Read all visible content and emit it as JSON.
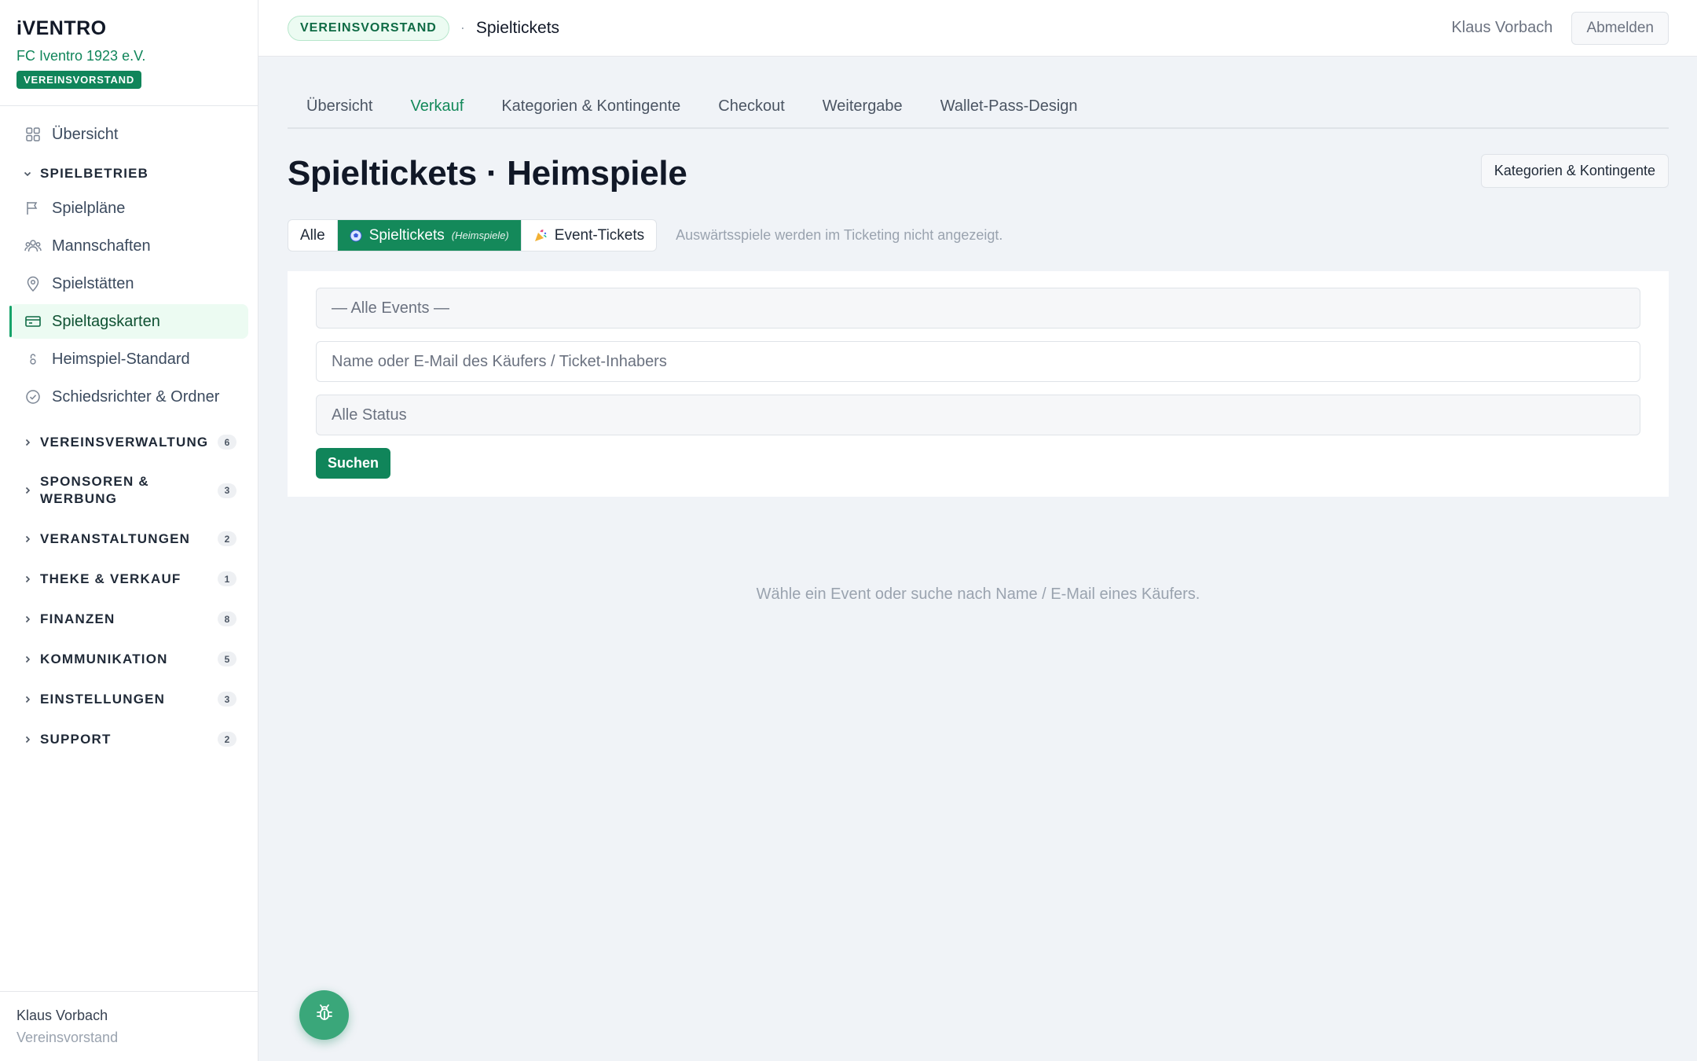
{
  "brand": {
    "logo": "iVENTRO",
    "club": "FC Iventro 1923 e.V.",
    "role_badge": "VEREINSVORSTAND"
  },
  "sidebar": {
    "top_item": {
      "label": "Übersicht",
      "icon": "grid-icon"
    },
    "open_group": {
      "label": "SPIELBETRIEB",
      "items": [
        {
          "label": "Spielpläne",
          "icon": "flag-icon"
        },
        {
          "label": "Mannschaften",
          "icon": "users-icon"
        },
        {
          "label": "Spielstätten",
          "icon": "map-pin-icon"
        },
        {
          "label": "Spieltagskarten",
          "icon": "ticket-icon",
          "active": true
        },
        {
          "label": "Heimspiel-Standard",
          "icon": "lock-icon"
        },
        {
          "label": "Schiedsrichter & Ordner",
          "icon": "check-circle-icon"
        }
      ]
    },
    "groups": [
      {
        "label": "VEREINSVERWALTUNG",
        "count": "6"
      },
      {
        "label": "SPONSOREN & WERBUNG",
        "count": "3"
      },
      {
        "label": "VERANSTALTUNGEN",
        "count": "2"
      },
      {
        "label": "THEKE & VERKAUF",
        "count": "1"
      },
      {
        "label": "FINANZEN",
        "count": "8"
      },
      {
        "label": "KOMMUNIKATION",
        "count": "5"
      },
      {
        "label": "EINSTELLUNGEN",
        "count": "3"
      },
      {
        "label": "SUPPORT",
        "count": "2"
      }
    ],
    "user": {
      "name": "Klaus Vorbach",
      "role": "Vereinsvorstand"
    }
  },
  "topbar": {
    "breadcrumb_badge": "VEREINSVORSTAND",
    "breadcrumb_sep": "·",
    "breadcrumb_title": "Spieltickets",
    "user": "Klaus Vorbach",
    "logout": "Abmelden"
  },
  "tabs": [
    {
      "label": "Übersicht",
      "active": false
    },
    {
      "label": "Verkauf",
      "active": true
    },
    {
      "label": "Kategorien & Kontingente",
      "active": false
    },
    {
      "label": "Checkout",
      "active": false
    },
    {
      "label": "Weitergabe",
      "active": false
    },
    {
      "label": "Wallet-Pass-Design",
      "active": false
    }
  ],
  "page": {
    "title": "Spieltickets · Heimspiele",
    "header_button": "Kategorien & Kontingente"
  },
  "filter": {
    "all": "Alle",
    "spieltickets": "Spieltickets",
    "spieltickets_sub": "(Heimspiele)",
    "event_tickets": "Event-Tickets",
    "hint": "Auswärtsspiele werden im Ticketing nicht angezeigt."
  },
  "search": {
    "event_select": "— Alle Events —",
    "name_placeholder": "Name oder E-Mail des Käufers / Ticket-Inhabers",
    "status_select": "Alle Status",
    "button": "Suchen"
  },
  "empty_state": "Wähle ein Event oder suche nach Name / E-Mail eines Käufers.",
  "colors": {
    "accent": "#10855a",
    "accent_light": "#ecfbf2",
    "background": "#f0f3f7",
    "fab": "#3aa77a"
  }
}
